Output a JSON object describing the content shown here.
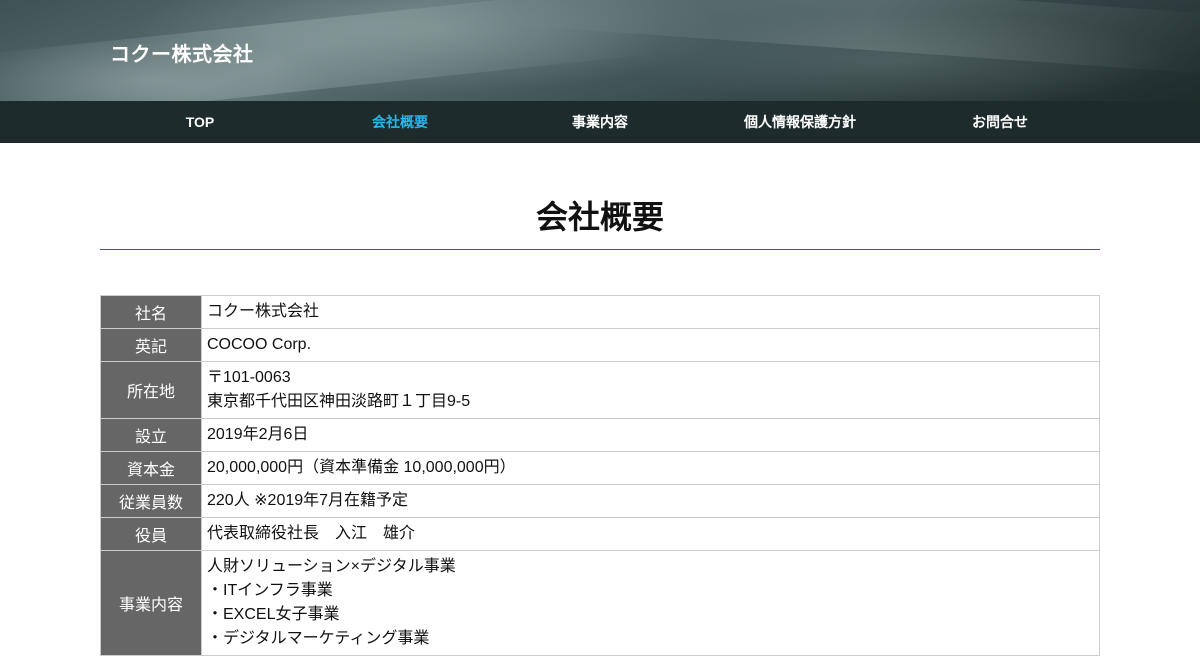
{
  "header": {
    "site_title": "コクー株式会社"
  },
  "nav": {
    "items": [
      {
        "label": "TOP"
      },
      {
        "label": "会社概要"
      },
      {
        "label": "事業内容"
      },
      {
        "label": "個人情報保護方針"
      },
      {
        "label": "お問合せ"
      }
    ],
    "active_index": 1,
    "active_color": "#2bb6e8"
  },
  "main": {
    "page_title": "会社概要",
    "rule_color": "#9c2b76",
    "table": [
      {
        "label": "社名",
        "lines": [
          "コクー株式会社"
        ]
      },
      {
        "label": "英記",
        "lines": [
          "COCOO Corp."
        ]
      },
      {
        "label": "所在地",
        "lines": [
          "〒101-0063",
          "東京都千代田区神田淡路町１丁目9-5"
        ]
      },
      {
        "label": "設立",
        "lines": [
          "2019年2月6日"
        ]
      },
      {
        "label": "資本金",
        "lines": [
          "20,000,000円（資本準備金 10,000,000円）"
        ]
      },
      {
        "label": "従業員数",
        "lines": [
          "220人 ※2019年7月在籍予定"
        ]
      },
      {
        "label": "役員",
        "lines": [
          "代表取締役社長　入江　雄介"
        ]
      },
      {
        "label": "事業内容",
        "lines": [
          "人財ソリューション×デジタル事業",
          "・ITインフラ事業",
          "・EXCEL女子事業",
          "・デジタルマーケティング事業"
        ]
      }
    ]
  }
}
